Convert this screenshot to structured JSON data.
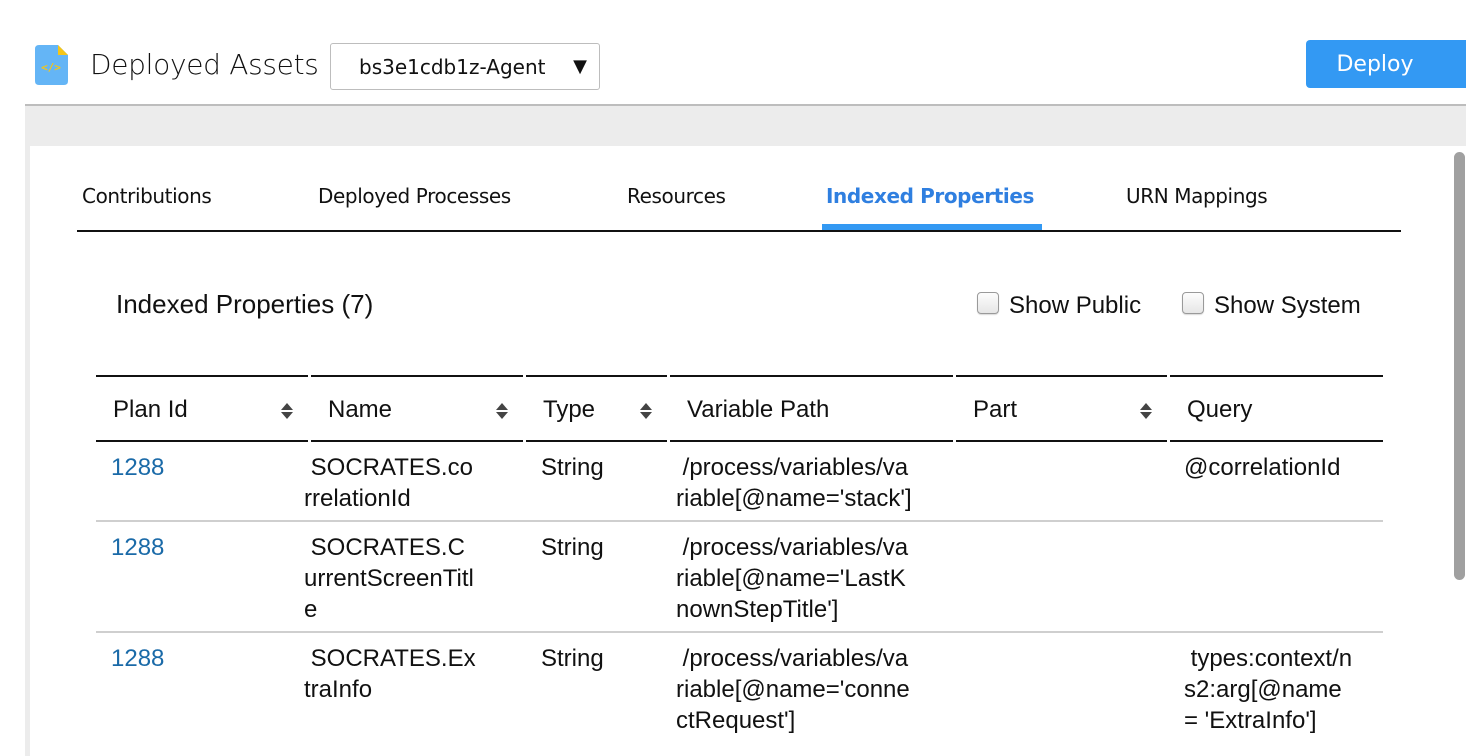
{
  "header": {
    "title": "Deployed Assets",
    "app_icon": "code-file-icon",
    "agent_select": {
      "value": "bs3e1cdb1z-Agent",
      "caret": "▼"
    },
    "deploy_label": "Deploy"
  },
  "tabs": [
    {
      "label": "Contributions",
      "active": false
    },
    {
      "label": "Deployed Processes",
      "active": false
    },
    {
      "label": "Resources",
      "active": false
    },
    {
      "label": "Indexed Properties",
      "active": true
    },
    {
      "label": "URN Mappings",
      "active": false
    }
  ],
  "section": {
    "title": "Indexed Properties (7)",
    "show_public": {
      "label": "Show Public",
      "checked": false
    },
    "show_system": {
      "label": "Show System",
      "checked": false
    }
  },
  "table": {
    "columns": [
      {
        "label": "Plan Id",
        "sortable": true
      },
      {
        "label": "Name",
        "sortable": true
      },
      {
        "label": "Type",
        "sortable": true
      },
      {
        "label": "Variable Path",
        "sortable": false
      },
      {
        "label": "Part",
        "sortable": true
      },
      {
        "label": "Query",
        "sortable": false
      }
    ],
    "rows": [
      {
        "plan_id": "1288",
        "name": " SOCRATES.co\nrrelationId",
        "type": "String",
        "variable_path": " /process/variables/va\nriable[@name='stack']",
        "part": "",
        "query": "@correlationId"
      },
      {
        "plan_id": "1288",
        "name": " SOCRATES.C\nurrentScreenTitl\ne",
        "type": "String",
        "variable_path": " /process/variables/va\nriable[@name='LastK\nnownStepTitle']",
        "part": "",
        "query": ""
      },
      {
        "plan_id": "1288",
        "name": " SOCRATES.Ex\ntraInfo",
        "type": "String",
        "variable_path": " /process/variables/va\nriable[@name='conne\nctRequest']",
        "part": "",
        "query": " types:context/n\ns2:arg[@name\n= 'ExtraInfo']"
      }
    ]
  },
  "colors": {
    "accent": "#3399f3",
    "active_tab": "#2f7fe0",
    "link": "#1a6aa8"
  }
}
